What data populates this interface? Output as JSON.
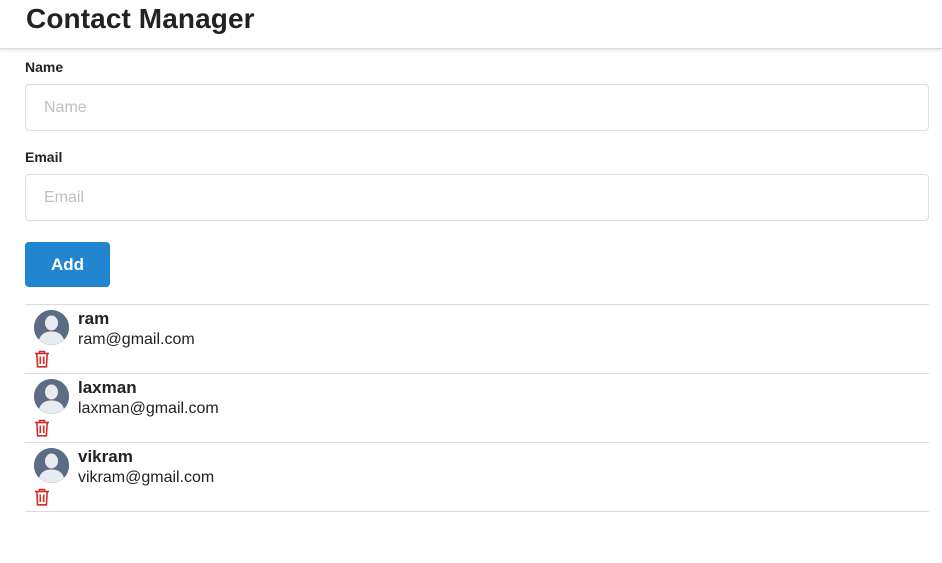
{
  "app": {
    "title": "Contact Manager"
  },
  "form": {
    "name_label": "Name",
    "name_placeholder": "Name",
    "name_value": "",
    "email_label": "Email",
    "email_placeholder": "Email",
    "email_value": "",
    "add_label": "Add"
  },
  "colors": {
    "accent": "#2185d0",
    "delete": "#db2828",
    "avatar": "#5c6c85"
  },
  "icons": {
    "avatar": "user-avatar-icon",
    "delete": "trash-icon"
  },
  "contacts": [
    {
      "name": "ram",
      "email": "ram@gmail.com"
    },
    {
      "name": "laxman",
      "email": "laxman@gmail.com"
    },
    {
      "name": "vikram",
      "email": "vikram@gmail.com"
    }
  ]
}
